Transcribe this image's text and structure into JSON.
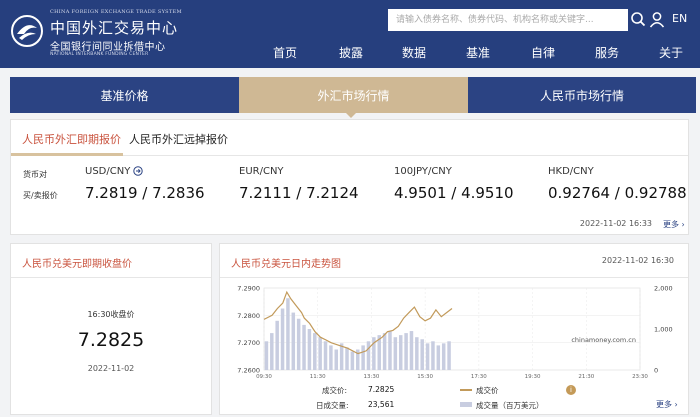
{
  "header": {
    "logo_en_top": "CHINA FOREIGN EXCHANGE TRADE SYSTEM",
    "logo_cn_top": "中国外汇交易中心",
    "logo_cn_bottom": "全国银行间同业拆借中心",
    "logo_en_bottom": "NATIONAL INTERBANK FUNDING CENTER",
    "search_placeholder": "请输入债券名称、债券代码、机构名称或关键字...",
    "lang": "EN",
    "search_icon": "search-icon",
    "user_icon": "user-icon",
    "menu_icon": "menu-icon"
  },
  "nav": [
    "首页",
    "披露",
    "数据",
    "基准",
    "自律",
    "服务",
    "关于"
  ],
  "tabs": [
    "基准价格",
    "外汇市场行情",
    "人民币市场行情"
  ],
  "spot": {
    "subtabs": [
      "人民币外汇即期报价",
      "人民币外汇远掉报价"
    ],
    "row_label_pair": "货币对",
    "row_label_quote": "买/卖报价",
    "pairs": [
      {
        "name": "USD/CNY",
        "quote": "7.2819 / 7.2836"
      },
      {
        "name": "EUR/CNY",
        "quote": "7.2111 / 7.2124"
      },
      {
        "name": "100JPY/CNY",
        "quote": "4.9501 / 4.9510"
      },
      {
        "name": "HKD/CNY",
        "quote": "0.92764 / 0.92788"
      }
    ],
    "time": "2022-11-02 16:33",
    "more": "更多 ›"
  },
  "closing": {
    "title": "人民币兑美元即期收盘价",
    "label": "16:30收盘价",
    "value": "7.2825",
    "date": "2022-11-02"
  },
  "trend": {
    "title": "人民币兑美元日内走势图",
    "time": "2022-11-02 16:30",
    "price_label": "成交价:",
    "price_value": "7.2825",
    "volume_label": "日成交量:",
    "volume_value": "23,561",
    "legend_price": "成交价",
    "legend_volume": "成交量（百万美元）",
    "info_icon": "info-icon",
    "info_glyph": "i",
    "more": "更多 ›",
    "watermark": "chinamoney.com.cn"
  },
  "chart_data": {
    "type": "line",
    "title": "人民币兑美元日内走势图",
    "x_ticks": [
      "09:30",
      "11:30",
      "13:30",
      "15:30",
      "17:30",
      "19:30",
      "21:30",
      "23:30"
    ],
    "y_left_ticks": [
      "7.2900",
      "7.2800",
      "7.2700",
      "7.2600"
    ],
    "y_left_range": [
      7.26,
      7.29
    ],
    "y_right_ticks": [
      "2,000",
      "1,000",
      "0"
    ],
    "y_right_range": [
      0,
      2000
    ],
    "x_range_hours": [
      9.5,
      23.5
    ],
    "grid": true,
    "series": [
      {
        "name": "成交价",
        "color": "#c29a5a",
        "x": [
          9.5,
          9.8,
          10.0,
          10.2,
          10.35,
          10.5,
          10.7,
          10.9,
          11.0,
          11.2,
          11.4,
          11.6,
          11.8,
          12.0,
          12.3,
          12.6,
          13.0,
          13.3,
          13.6,
          13.9,
          14.1,
          14.3,
          14.5,
          14.7,
          14.9,
          15.1,
          15.3,
          15.5,
          15.7,
          15.9,
          16.1,
          16.3,
          16.5
        ],
        "y": [
          7.2785,
          7.28,
          7.2825,
          7.2845,
          7.2885,
          7.286,
          7.2835,
          7.281,
          7.279,
          7.277,
          7.274,
          7.272,
          7.271,
          7.27,
          7.269,
          7.268,
          7.266,
          7.267,
          7.27,
          7.272,
          7.274,
          7.2745,
          7.276,
          7.279,
          7.281,
          7.283,
          7.2795,
          7.278,
          7.279,
          7.282,
          7.2795,
          7.281,
          7.2825
        ]
      },
      {
        "name": "成交量（百万美元）",
        "color": "#c8cde0",
        "x": [
          9.6,
          9.8,
          10.0,
          10.2,
          10.4,
          10.6,
          10.8,
          11.0,
          11.2,
          11.4,
          11.6,
          11.8,
          12.0,
          12.2,
          12.4,
          12.6,
          12.8,
          13.0,
          13.2,
          13.4,
          13.6,
          13.8,
          14.0,
          14.2,
          14.4,
          14.6,
          14.8,
          15.0,
          15.2,
          15.4,
          15.6,
          15.8,
          16.0,
          16.2,
          16.4
        ],
        "y": [
          700,
          900,
          1200,
          1500,
          1750,
          1400,
          1250,
          1100,
          1000,
          900,
          800,
          700,
          600,
          500,
          650,
          550,
          450,
          500,
          600,
          700,
          800,
          850,
          900,
          950,
          800,
          850,
          900,
          950,
          800,
          750,
          650,
          700,
          600,
          650,
          700
        ]
      }
    ]
  }
}
